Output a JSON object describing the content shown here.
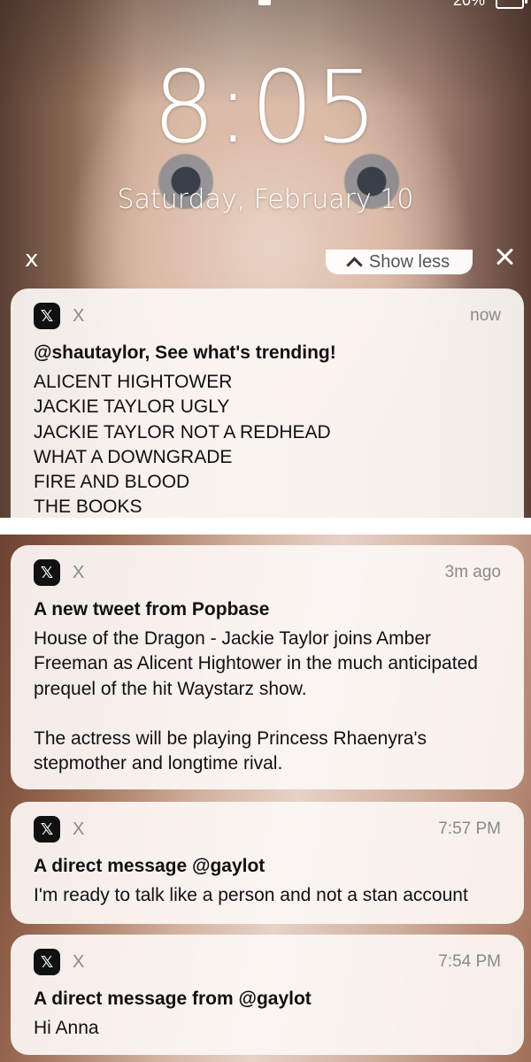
{
  "status_bar": {
    "left": "",
    "battery_percent": "20%"
  },
  "lock_screen": {
    "time": "8:05",
    "date": "Saturday, February 10"
  },
  "group_controls": {
    "clear_label": "x",
    "show_less_label": "Show less"
  },
  "notifications": [
    {
      "app": "X",
      "logo": "𝕏",
      "time": "now",
      "title": "@shautaylor, See what's trending!",
      "lines": [
        "ALICENT HIGHTOWER",
        "JACKIE TAYLOR UGLY",
        "JACKIE TAYLOR NOT A REDHEAD",
        "WHAT A DOWNGRADE",
        "FIRE AND BLOOD",
        "THE BOOKS"
      ]
    },
    {
      "app": "X",
      "logo": "𝕏",
      "time": "3m ago",
      "title": "A new tweet from Popbase",
      "paragraphs": [
        "House of the Dragon - Jackie Taylor joins Amber Freeman as Alicent Hightower in the much anticipated prequel of the hit Waystarz show.",
        "The actress will be playing Princess Rhaenyra's stepmother and longtime rival."
      ]
    },
    {
      "app": "X",
      "logo": "𝕏",
      "time": "7:57 PM",
      "title": "A direct message @gaylot",
      "body": "I'm ready to talk like a person and not a stan account"
    },
    {
      "app": "X",
      "logo": "𝕏",
      "time": "7:54 PM",
      "title": "A direct message from @gaylot",
      "body": "Hi Anna"
    }
  ]
}
